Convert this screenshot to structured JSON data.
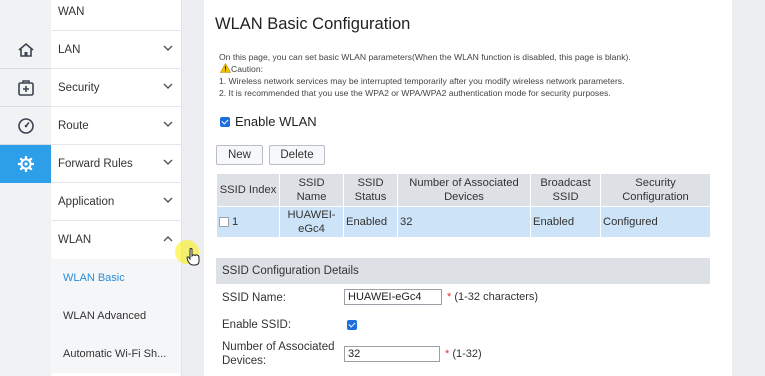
{
  "icon_bar": [
    {
      "icon": "home-icon"
    },
    {
      "icon": "plus-box-icon"
    },
    {
      "icon": "gauge-icon"
    },
    {
      "icon": "gear-icon",
      "active": true
    }
  ],
  "sidebar": {
    "items": [
      {
        "label": "WAN"
      },
      {
        "label": "LAN"
      },
      {
        "label": "Security"
      },
      {
        "label": "Route"
      },
      {
        "label": "Forward Rules"
      },
      {
        "label": "Application"
      },
      {
        "label": "WLAN",
        "expanded": true
      }
    ],
    "subitems": [
      {
        "label": "WLAN Basic",
        "active": true
      },
      {
        "label": "WLAN Advanced"
      },
      {
        "label": "Automatic Wi-Fi Sh..."
      }
    ]
  },
  "page": {
    "title": "WLAN Basic Configuration",
    "intro": "On this page, you can set basic WLAN parameters(When the WLAN function is disabled, this page is blank).",
    "caution_label": "Caution:",
    "caution_1": "1. Wireless network services may be interrupted temporarily after you modify wireless network parameters.",
    "caution_2": "2. It is recommended that you use the WPA2 or WPA/WPA2 authentication mode for security purposes.",
    "enable_wlan_label": "Enable WLAN",
    "new_button": "New",
    "delete_button": "Delete"
  },
  "ssid_table": {
    "headers": [
      "SSID Index",
      "SSID Name",
      "SSID Status",
      "Number of Associated Devices",
      "Broadcast SSID",
      "Security Configuration"
    ],
    "rows": [
      [
        "1",
        "HUAWEI-eGc4",
        "Enabled",
        "32",
        "Enabled",
        "Configured"
      ]
    ]
  },
  "details": {
    "title": "SSID Configuration Details",
    "ssid_name_label": "SSID Name:",
    "ssid_name_value": "HUAWEI-eGc4",
    "ssid_name_hint": "(1-32 characters)",
    "enable_ssid_label": "Enable SSID:",
    "assoc_label": "Number of Associated Devices:",
    "assoc_value": "32",
    "assoc_hint": "(1-32)",
    "required_mark": "*"
  },
  "colors": {
    "accent": "#2d9ee8",
    "selected_row": "#cde3f7",
    "header_bg": "#dde0e5"
  }
}
